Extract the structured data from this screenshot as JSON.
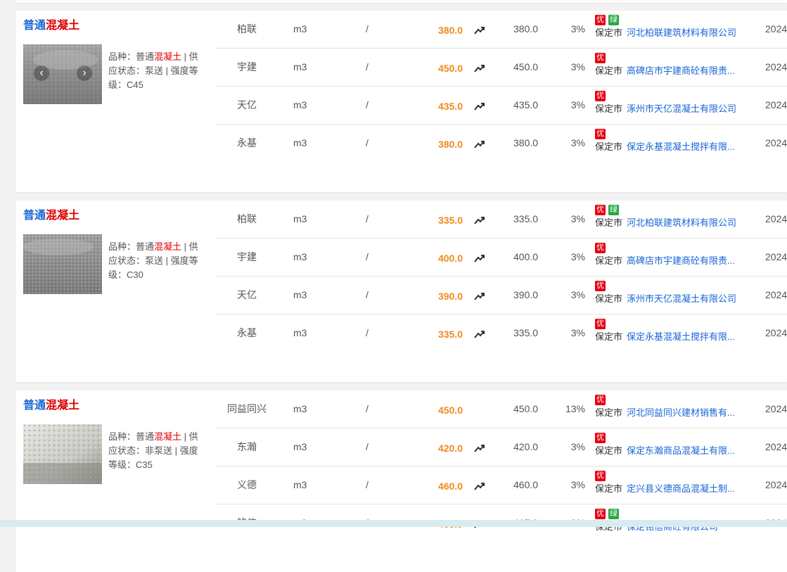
{
  "cards": [
    {
      "title_a": "普通",
      "title_b": "混凝土",
      "desc": {
        "pre": "品种：普通",
        "hl": "混凝土",
        "post": " | 供应状态：泵送 | 强度等级：C45"
      },
      "nav": {
        "prev": "‹",
        "next": "›"
      },
      "rows": [
        {
          "brand": "柏联",
          "unit": "m3",
          "sep": "/",
          "price": "380.0",
          "prev": "380.0",
          "pct": "3%",
          "you": "优",
          "lv": "绿",
          "loc": "保定市",
          "company": "河北柏联建筑材料有限公司",
          "date": "2024"
        },
        {
          "brand": "宇建",
          "unit": "m3",
          "sep": "/",
          "price": "450.0",
          "prev": "450.0",
          "pct": "3%",
          "you": "优",
          "lv": "",
          "loc": "保定市",
          "company": "高碑店市宇建商砼有限责...",
          "date": "2024"
        },
        {
          "brand": "天亿",
          "unit": "m3",
          "sep": "/",
          "price": "435.0",
          "prev": "435.0",
          "pct": "3%",
          "you": "优",
          "lv": "",
          "loc": "保定市",
          "company": "涿州市天亿混凝土有限公司",
          "date": "2024"
        },
        {
          "brand": "永基",
          "unit": "m3",
          "sep": "/",
          "price": "380.0",
          "prev": "380.0",
          "pct": "3%",
          "you": "优",
          "lv": "",
          "loc": "保定市",
          "company": "保定永基混凝土搅拌有限...",
          "date": "2024"
        }
      ]
    },
    {
      "title_a": "普通",
      "title_b": "混凝土",
      "desc": {
        "pre": "品种：普通",
        "hl": "混凝土",
        "post": " | 供应状态：泵送 | 强度等级：C30"
      },
      "rows": [
        {
          "brand": "柏联",
          "unit": "m3",
          "sep": "/",
          "price": "335.0",
          "prev": "335.0",
          "pct": "3%",
          "you": "优",
          "lv": "绿",
          "loc": "保定市",
          "company": "河北柏联建筑材料有限公司",
          "date": "2024"
        },
        {
          "brand": "宇建",
          "unit": "m3",
          "sep": "/",
          "price": "400.0",
          "prev": "400.0",
          "pct": "3%",
          "you": "优",
          "lv": "",
          "loc": "保定市",
          "company": "高碑店市宇建商砼有限责...",
          "date": "2024"
        },
        {
          "brand": "天亿",
          "unit": "m3",
          "sep": "/",
          "price": "390.0",
          "prev": "390.0",
          "pct": "3%",
          "you": "优",
          "lv": "",
          "loc": "保定市",
          "company": "涿州市天亿混凝土有限公司",
          "date": "2024"
        },
        {
          "brand": "永基",
          "unit": "m3",
          "sep": "/",
          "price": "335.0",
          "prev": "335.0",
          "pct": "3%",
          "you": "优",
          "lv": "",
          "loc": "保定市",
          "company": "保定永基混凝土搅拌有限...",
          "date": "2024"
        }
      ]
    },
    {
      "title_a": "普通",
      "title_b": "混凝土",
      "desc": {
        "pre": "品种：普通",
        "hl": "混凝土",
        "post": " | 供应状态：非泵送 | 强度等级：C35"
      },
      "rows": [
        {
          "brand": "同益同兴",
          "unit": "m3",
          "sep": "/",
          "price": "450.0",
          "prev": "450.0",
          "pct": "13%",
          "you": "优",
          "lv": "",
          "loc": "保定市",
          "company": "河北同益同兴建材销售有...",
          "date": "2024"
        },
        {
          "brand": "东瀚",
          "unit": "m3",
          "sep": "/",
          "price": "420.0",
          "prev": "420.0",
          "pct": "3%",
          "you": "优",
          "lv": "",
          "loc": "保定市",
          "company": "保定东瀚商品混凝土有限...",
          "date": "2024"
        },
        {
          "brand": "义德",
          "unit": "m3",
          "sep": "/",
          "price": "460.0",
          "prev": "460.0",
          "pct": "3%",
          "you": "优",
          "lv": "",
          "loc": "保定市",
          "company": "定兴县义德商品混凝土制...",
          "date": "2024"
        },
        {
          "brand": "铭信",
          "unit": "m3",
          "sep": "/",
          "price": "465.0",
          "prev": "465.0",
          "pct": "3%",
          "you": "优",
          "lv": "绿",
          "loc": "保定市",
          "company": "保定铭信商砼有限公司",
          "date": "2024"
        }
      ]
    }
  ],
  "icons": {
    "trend": "trend-up-icon",
    "arrows": [
      "chevron-left-icon",
      "chevron-right-icon"
    ]
  },
  "colors": {
    "blue": "#1766d6",
    "red": "#e00000",
    "orange": "#f08a1c",
    "you_badge": "#e60012",
    "green_badge": "#28a745"
  }
}
